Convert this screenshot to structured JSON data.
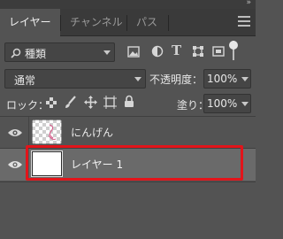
{
  "panel": {
    "collapse_glyph": "»",
    "tabs": [
      {
        "label": "レイヤー",
        "active": true
      },
      {
        "label": "チャンネル",
        "active": false
      },
      {
        "label": "パス",
        "active": false
      }
    ],
    "menu_icon": "hamburger-icon"
  },
  "filter": {
    "search_icon": "search-icon",
    "kind_label": "種類",
    "filter_icons": [
      "image-filter-icon",
      "adjustment-filter-icon",
      "type-filter-icon",
      "shape-filter-icon",
      "smart-object-filter-icon"
    ]
  },
  "blend": {
    "mode_label": "通常",
    "opacity_label": "不透明度：",
    "opacity_value": "100%"
  },
  "lock": {
    "label": "ロック：",
    "icons": [
      "lock-transparent-pixels-icon",
      "lock-image-pixels-icon",
      "lock-position-icon",
      "lock-artboard-icon",
      "lock-all-icon"
    ],
    "fill_label": "塗り：",
    "fill_value": "100%"
  },
  "layers": [
    {
      "name": "にんげん",
      "visible": true,
      "selected": false,
      "thumbnail": "checkerboard-with-sketch"
    },
    {
      "name": "レイヤー 1",
      "visible": true,
      "selected": true,
      "thumbnail": "white-fill"
    }
  ],
  "colors": {
    "panel_bg": "#535353",
    "selected_row": "#6a6a6a",
    "highlight_border": "#e2141a"
  }
}
